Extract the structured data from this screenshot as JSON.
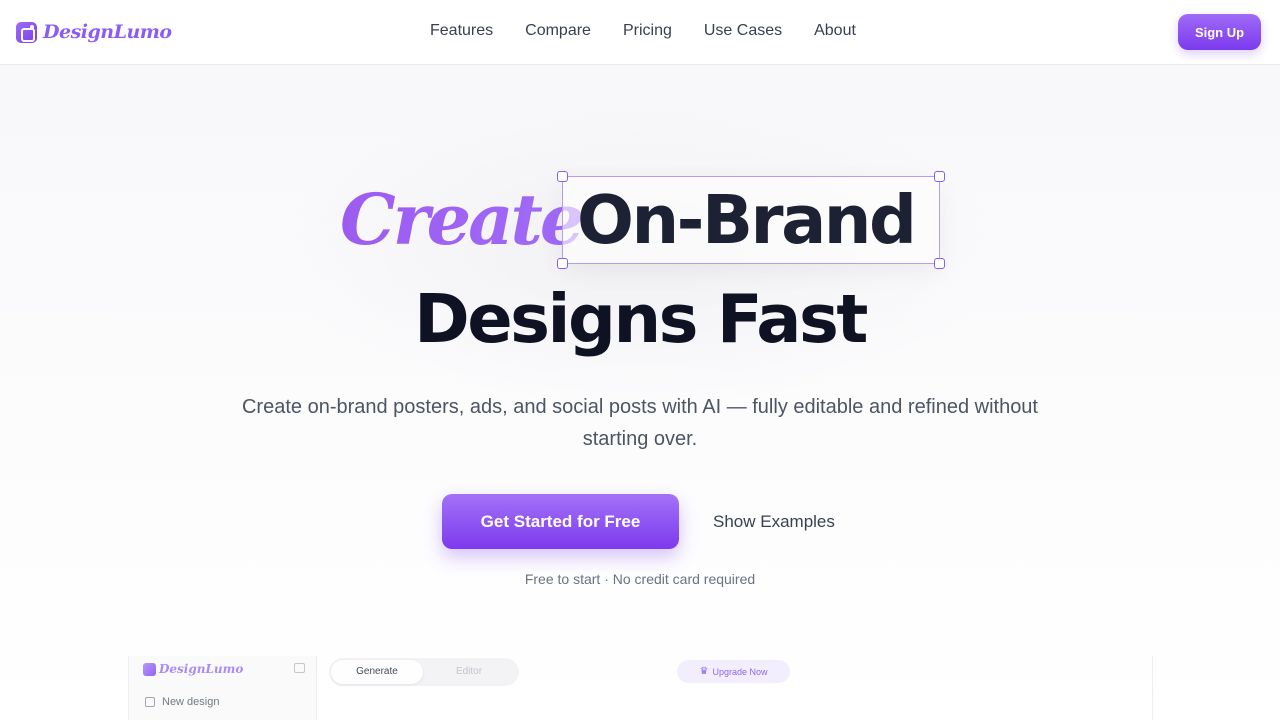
{
  "brand": {
    "name": "DesignLumo",
    "accent": "#7c3aed",
    "accent_light": "#a06bf7"
  },
  "nav": {
    "links": [
      "Features",
      "Compare",
      "Pricing",
      "Use Cases",
      "About"
    ],
    "signup_label": "Sign Up"
  },
  "hero": {
    "word_create": "Create",
    "word_brand": "On-Brand",
    "line2": "Designs Fast",
    "subtitle": "Create on-brand posters, ads, and social posts with AI — fully editable and refined without starting over.",
    "cta_primary": "Get Started for Free",
    "cta_secondary": "Show Examples",
    "note": "Free to start · No credit card required"
  },
  "preview": {
    "logo": "DesignLumo",
    "new_design": "New design",
    "tabs": [
      "Generate",
      "Editor"
    ],
    "active_tab": "Generate",
    "upgrade_label": "Upgrade Now"
  },
  "icons": [
    "logo-icon",
    "panel-toggle-icon",
    "edit-icon",
    "crown-icon"
  ]
}
